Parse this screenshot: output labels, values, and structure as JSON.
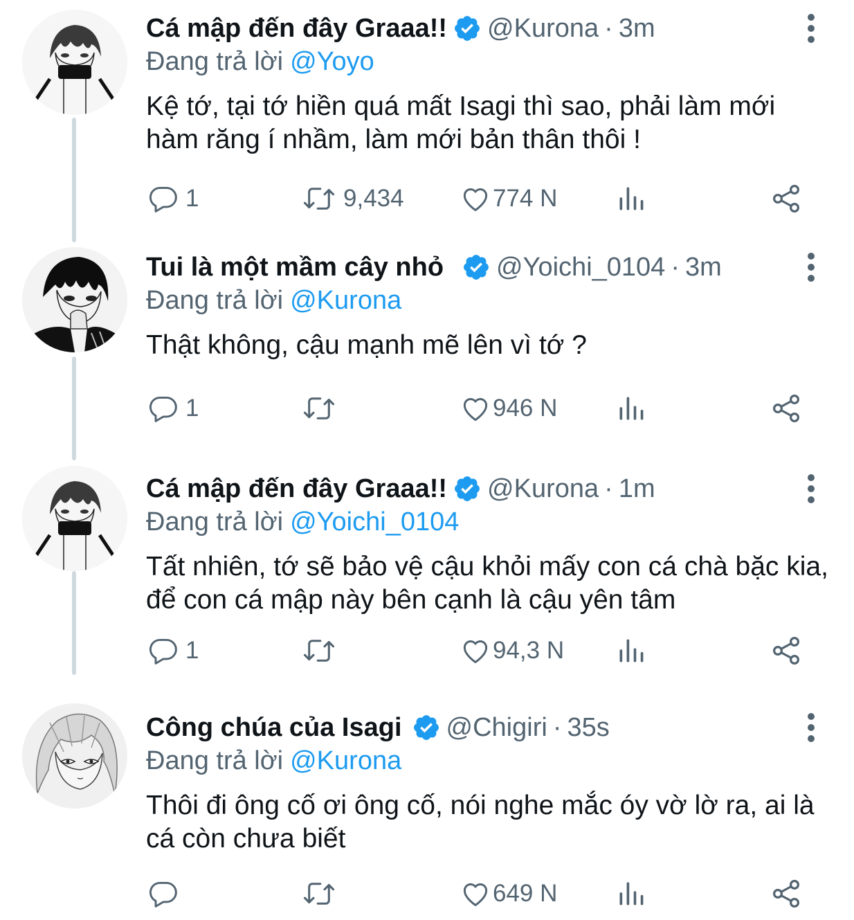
{
  "tweets": [
    {
      "display_name": "Cá mập đến đây Graaa!!",
      "handle": "@Kurona",
      "separator": "·",
      "time": "3m",
      "reply_prefix": "Đang trả lời",
      "reply_to": "@Yoyo",
      "text": "Kệ tớ, tại tớ hiền quá mất Isagi thì sao, phải làm mới hàm răng í nhầm, làm mới bản thân thôi !",
      "replies": "1",
      "retweets": "9,434",
      "likes": "774 N",
      "avatar": "kurona-avatar",
      "verified": true
    },
    {
      "display_name": "Tui là một mầm cây nhỏ",
      "handle": "@Yoichi_0104",
      "separator": "·",
      "time": "3m",
      "reply_prefix": "Đang trả lời",
      "reply_to": "@Kurona",
      "text": "Thật không, cậu mạnh mẽ lên vì tớ ?",
      "replies": "1",
      "retweets": "",
      "likes": "946 N",
      "avatar": "yoichi-avatar",
      "verified": true
    },
    {
      "display_name": "Cá mập đến đây Graaa!!",
      "handle": "@Kurona",
      "separator": "·",
      "time": "1m",
      "reply_prefix": "Đang trả lời",
      "reply_to": "@Yoichi_0104",
      "text": "Tất nhiên, tớ sẽ bảo vệ cậu khỏi mấy con cá chà bặc kia, để con cá mập này bên cạnh là cậu yên tâm",
      "replies": "1",
      "retweets": "",
      "likes": "94,3 N",
      "avatar": "kurona-avatar",
      "verified": true
    },
    {
      "display_name": "Công chúa của Isagi",
      "handle": "@Chigiri",
      "separator": "·",
      "time": "35s",
      "reply_prefix": "Đang trả lời",
      "reply_to": "@Kurona",
      "text": "Thôi đi ông cố ơi ông cố, nói nghe mắc óy vờ lờ ra, ai là cá còn chưa biết",
      "replies": "",
      "retweets": "",
      "likes": "649 N",
      "avatar": "chigiri-avatar",
      "verified": true
    }
  ],
  "colors": {
    "text": "#0f1419",
    "secondary": "#536471",
    "accent": "#1d9bf0",
    "thread_line": "#cfd9de"
  },
  "icons": [
    "reply-icon",
    "retweet-icon",
    "like-icon",
    "views-icon",
    "share-icon",
    "more-icon",
    "verified-badge-icon"
  ]
}
